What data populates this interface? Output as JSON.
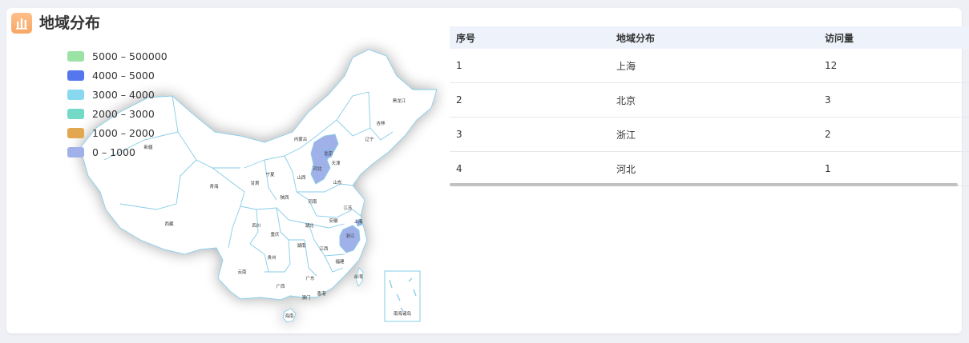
{
  "panel": {
    "title": "地域分布",
    "icon": "bar-chart-icon"
  },
  "legend": {
    "items": [
      {
        "label": "5000 – 500000",
        "color": "#9be3a5"
      },
      {
        "label": "4000 – 5000",
        "color": "#5577ee"
      },
      {
        "label": "3000 – 4000",
        "color": "#88d8ef"
      },
      {
        "label": "2000 – 3000",
        "color": "#72dac6"
      },
      {
        "label": "1000 – 2000",
        "color": "#e3a84f"
      },
      {
        "label": "0 – 1000",
        "color": "#9fb1e8"
      }
    ]
  },
  "map": {
    "provinces": [
      "黑龙江",
      "吉林",
      "辽宁",
      "内蒙古",
      "新疆",
      "宁夏",
      "北京",
      "天津",
      "河北",
      "山西",
      "山东",
      "青海",
      "甘肃",
      "陕西",
      "河南",
      "江苏",
      "安徽",
      "上海",
      "西藏",
      "四川",
      "湖北",
      "浙江",
      "重庆",
      "湖南",
      "江西",
      "贵州",
      "云南",
      "福建",
      "广西",
      "广东",
      "台湾",
      "澳门",
      "香港",
      "海南",
      "南海诸岛"
    ],
    "highlight_color": "#9fb1e8"
  },
  "table": {
    "headers": [
      "序号",
      "地域分布",
      "访问量"
    ],
    "rows": [
      [
        "1",
        "上海",
        "12"
      ],
      [
        "2",
        "北京",
        "3"
      ],
      [
        "3",
        "浙江",
        "2"
      ],
      [
        "4",
        "河北",
        "1"
      ]
    ]
  }
}
